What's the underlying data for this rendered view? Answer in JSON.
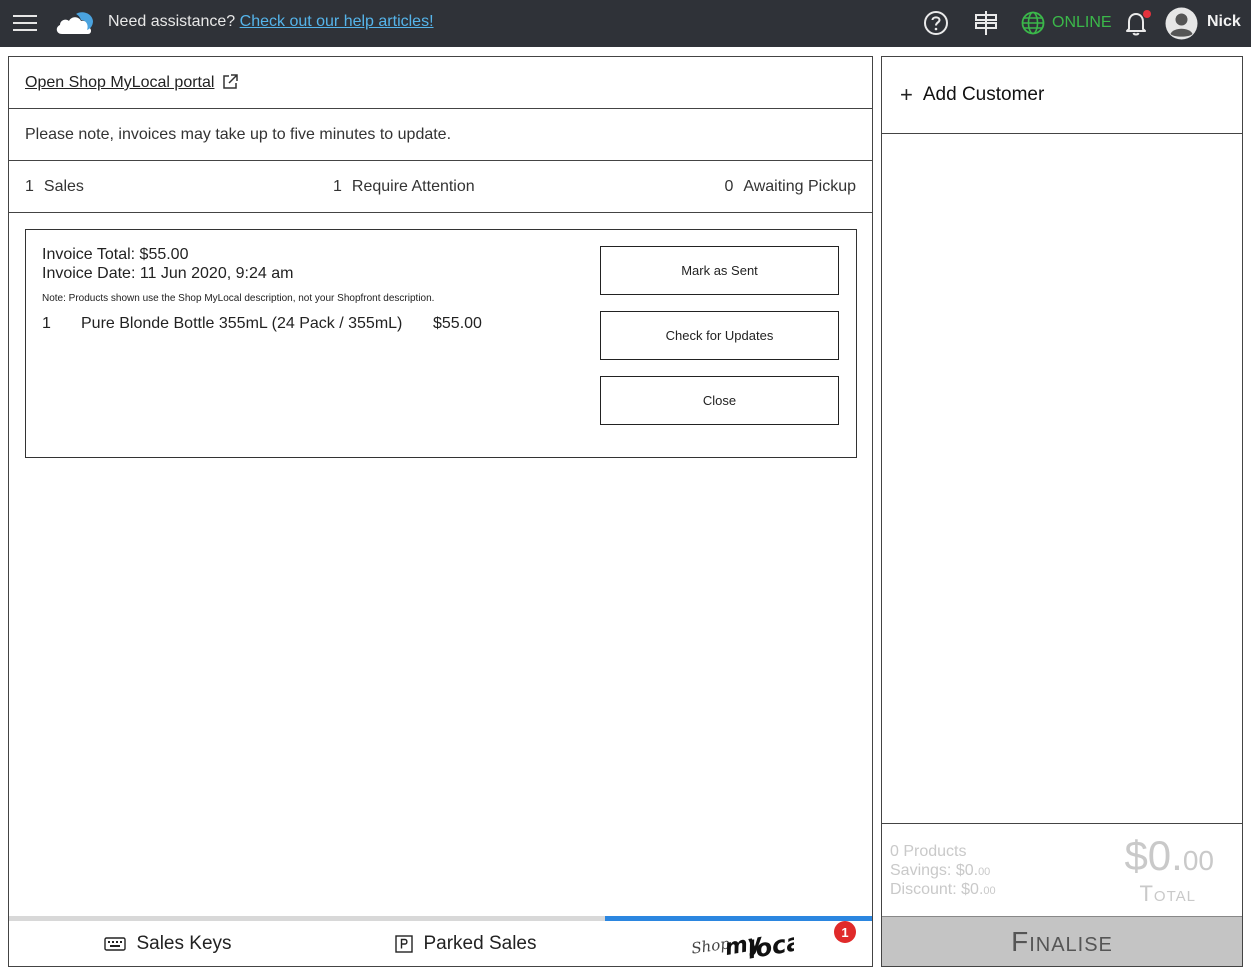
{
  "topbar": {
    "assist_text": "Need assistance?",
    "assist_link": "Check out our help articles!",
    "status": "ONLINE",
    "user_name": "Nick",
    "icons": [
      "menu-icon",
      "cloud-logo-icon",
      "help-icon",
      "signpost-icon",
      "globe-icon",
      "bell-icon",
      "user-avatar-icon"
    ],
    "colors": {
      "bar": "#2f3238",
      "link": "#55b4ea",
      "online": "#3bb84a",
      "notification": "#e5323d"
    }
  },
  "portal": {
    "link_label": "Open Shop MyLocal portal"
  },
  "notice": {
    "text": "Please note, invoices may take up to five minutes to update."
  },
  "stats": {
    "sales_count": "1",
    "sales_label": "Sales",
    "attention_count": "1",
    "attention_label": "Require Attention",
    "pickup_count": "0",
    "pickup_label": "Awaiting Pickup"
  },
  "invoice": {
    "total_line": "Invoice Total: $55.00",
    "date_line": "Invoice Date: 11 Jun 2020, 9:24 am",
    "note": "Note: Products shown use the Shop MyLocal description, not your Shopfront description.",
    "items": [
      {
        "qty": "1",
        "name": "Pure Blonde Bottle 355mL (24 Pack / 355mL)",
        "price": "$55.00"
      }
    ],
    "buttons": {
      "mark_sent": "Mark as Sent",
      "check_updates": "Check for Updates",
      "close": "Close"
    }
  },
  "tabs": {
    "sales_keys": "Sales Keys",
    "parked_sales": "Parked Sales",
    "shop_mylocal_logo": "ShopMyLocal",
    "badge_count": "1",
    "active_color": "#2b86e0"
  },
  "cart": {
    "add_customer": "Add Customer",
    "products": "0 Products",
    "savings_label": "Savings: $0.",
    "savings_cents": "00",
    "discount_label": "Discount: $0.",
    "discount_cents": "00",
    "total_dollars": "$0.",
    "total_cents": "00",
    "total_label": "Total",
    "finalise": "Finalise"
  }
}
